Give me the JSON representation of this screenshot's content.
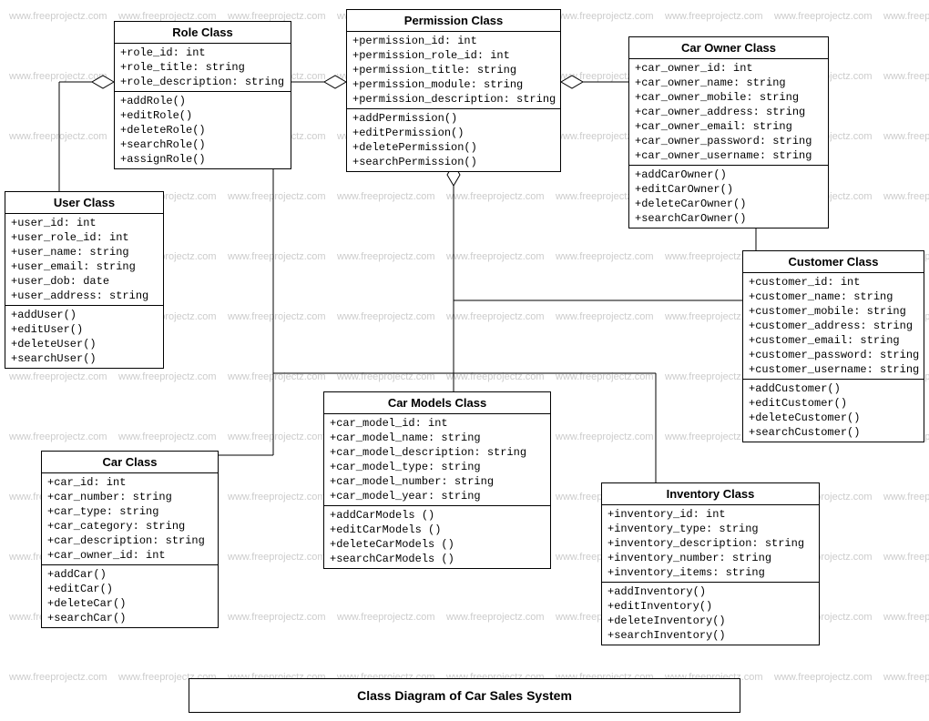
{
  "title": "Class Diagram of Car Sales System",
  "watermark": "www.freeprojectz.com",
  "classes": {
    "role": {
      "name": "Role Class",
      "attrs": [
        "+role_id: int",
        "+role_title: string",
        "+role_description: string"
      ],
      "ops": [
        "+addRole()",
        "+editRole()",
        "+deleteRole()",
        "+searchRole()",
        "+assignRole()"
      ]
    },
    "permission": {
      "name": "Permission Class",
      "attrs": [
        "+permission_id: int",
        "+permission_role_id: int",
        "+permission_title: string",
        "+permission_module: string",
        "+permission_description: string"
      ],
      "ops": [
        "+addPermission()",
        "+editPermission()",
        "+deletePermission()",
        "+searchPermission()"
      ]
    },
    "carowner": {
      "name": "Car Owner Class",
      "attrs": [
        "+car_owner_id: int",
        "+car_owner_name: string",
        "+car_owner_mobile: string",
        "+car_owner_address: string",
        "+car_owner_email: string",
        "+car_owner_password: string",
        "+car_owner_username: string"
      ],
      "ops": [
        "+addCarOwner()",
        "+editCarOwner()",
        "+deleteCarOwner()",
        "+searchCarOwner()"
      ]
    },
    "user": {
      "name": "User Class",
      "attrs": [
        "+user_id: int",
        "+user_role_id: int",
        "+user_name: string",
        "+user_email: string",
        "+user_dob: date",
        "+user_address: string"
      ],
      "ops": [
        "+addUser()",
        "+editUser()",
        "+deleteUser()",
        "+searchUser()"
      ]
    },
    "customer": {
      "name": "Customer Class",
      "attrs": [
        "+customer_id: int",
        "+customer_name: string",
        "+customer_mobile: string",
        "+customer_address: string",
        "+customer_email: string",
        "+customer_password: string",
        "+customer_username: string"
      ],
      "ops": [
        "+addCustomer()",
        "+editCustomer()",
        "+deleteCustomer()",
        "+searchCustomer()"
      ]
    },
    "carmodels": {
      "name": "Car Models Class",
      "attrs": [
        "+car_model_id: int",
        "+car_model_name: string",
        "+car_model_description: string",
        "+car_model_type: string",
        "+car_model_number: string",
        "+car_model_year: string"
      ],
      "ops": [
        "+addCarModels ()",
        "+editCarModels ()",
        "+deleteCarModels ()",
        "+searchCarModels ()"
      ]
    },
    "car": {
      "name": "Car Class",
      "attrs": [
        "+car_id: int",
        "+car_number: string",
        "+car_type: string",
        "+car_category: string",
        "+car_description: string",
        "+car_owner_id: int"
      ],
      "ops": [
        "+addCar()",
        "+editCar()",
        "+deleteCar()",
        "+searchCar()"
      ]
    },
    "inventory": {
      "name": "Inventory Class",
      "attrs": [
        "+inventory_id: int",
        "+inventory_type: string",
        "+inventory_description: string",
        "+inventory_number: string",
        "+inventory_items: string"
      ],
      "ops": [
        "+addInventory()",
        "+editInventory()",
        "+deleteInventory()",
        "+searchInventory()"
      ]
    }
  }
}
